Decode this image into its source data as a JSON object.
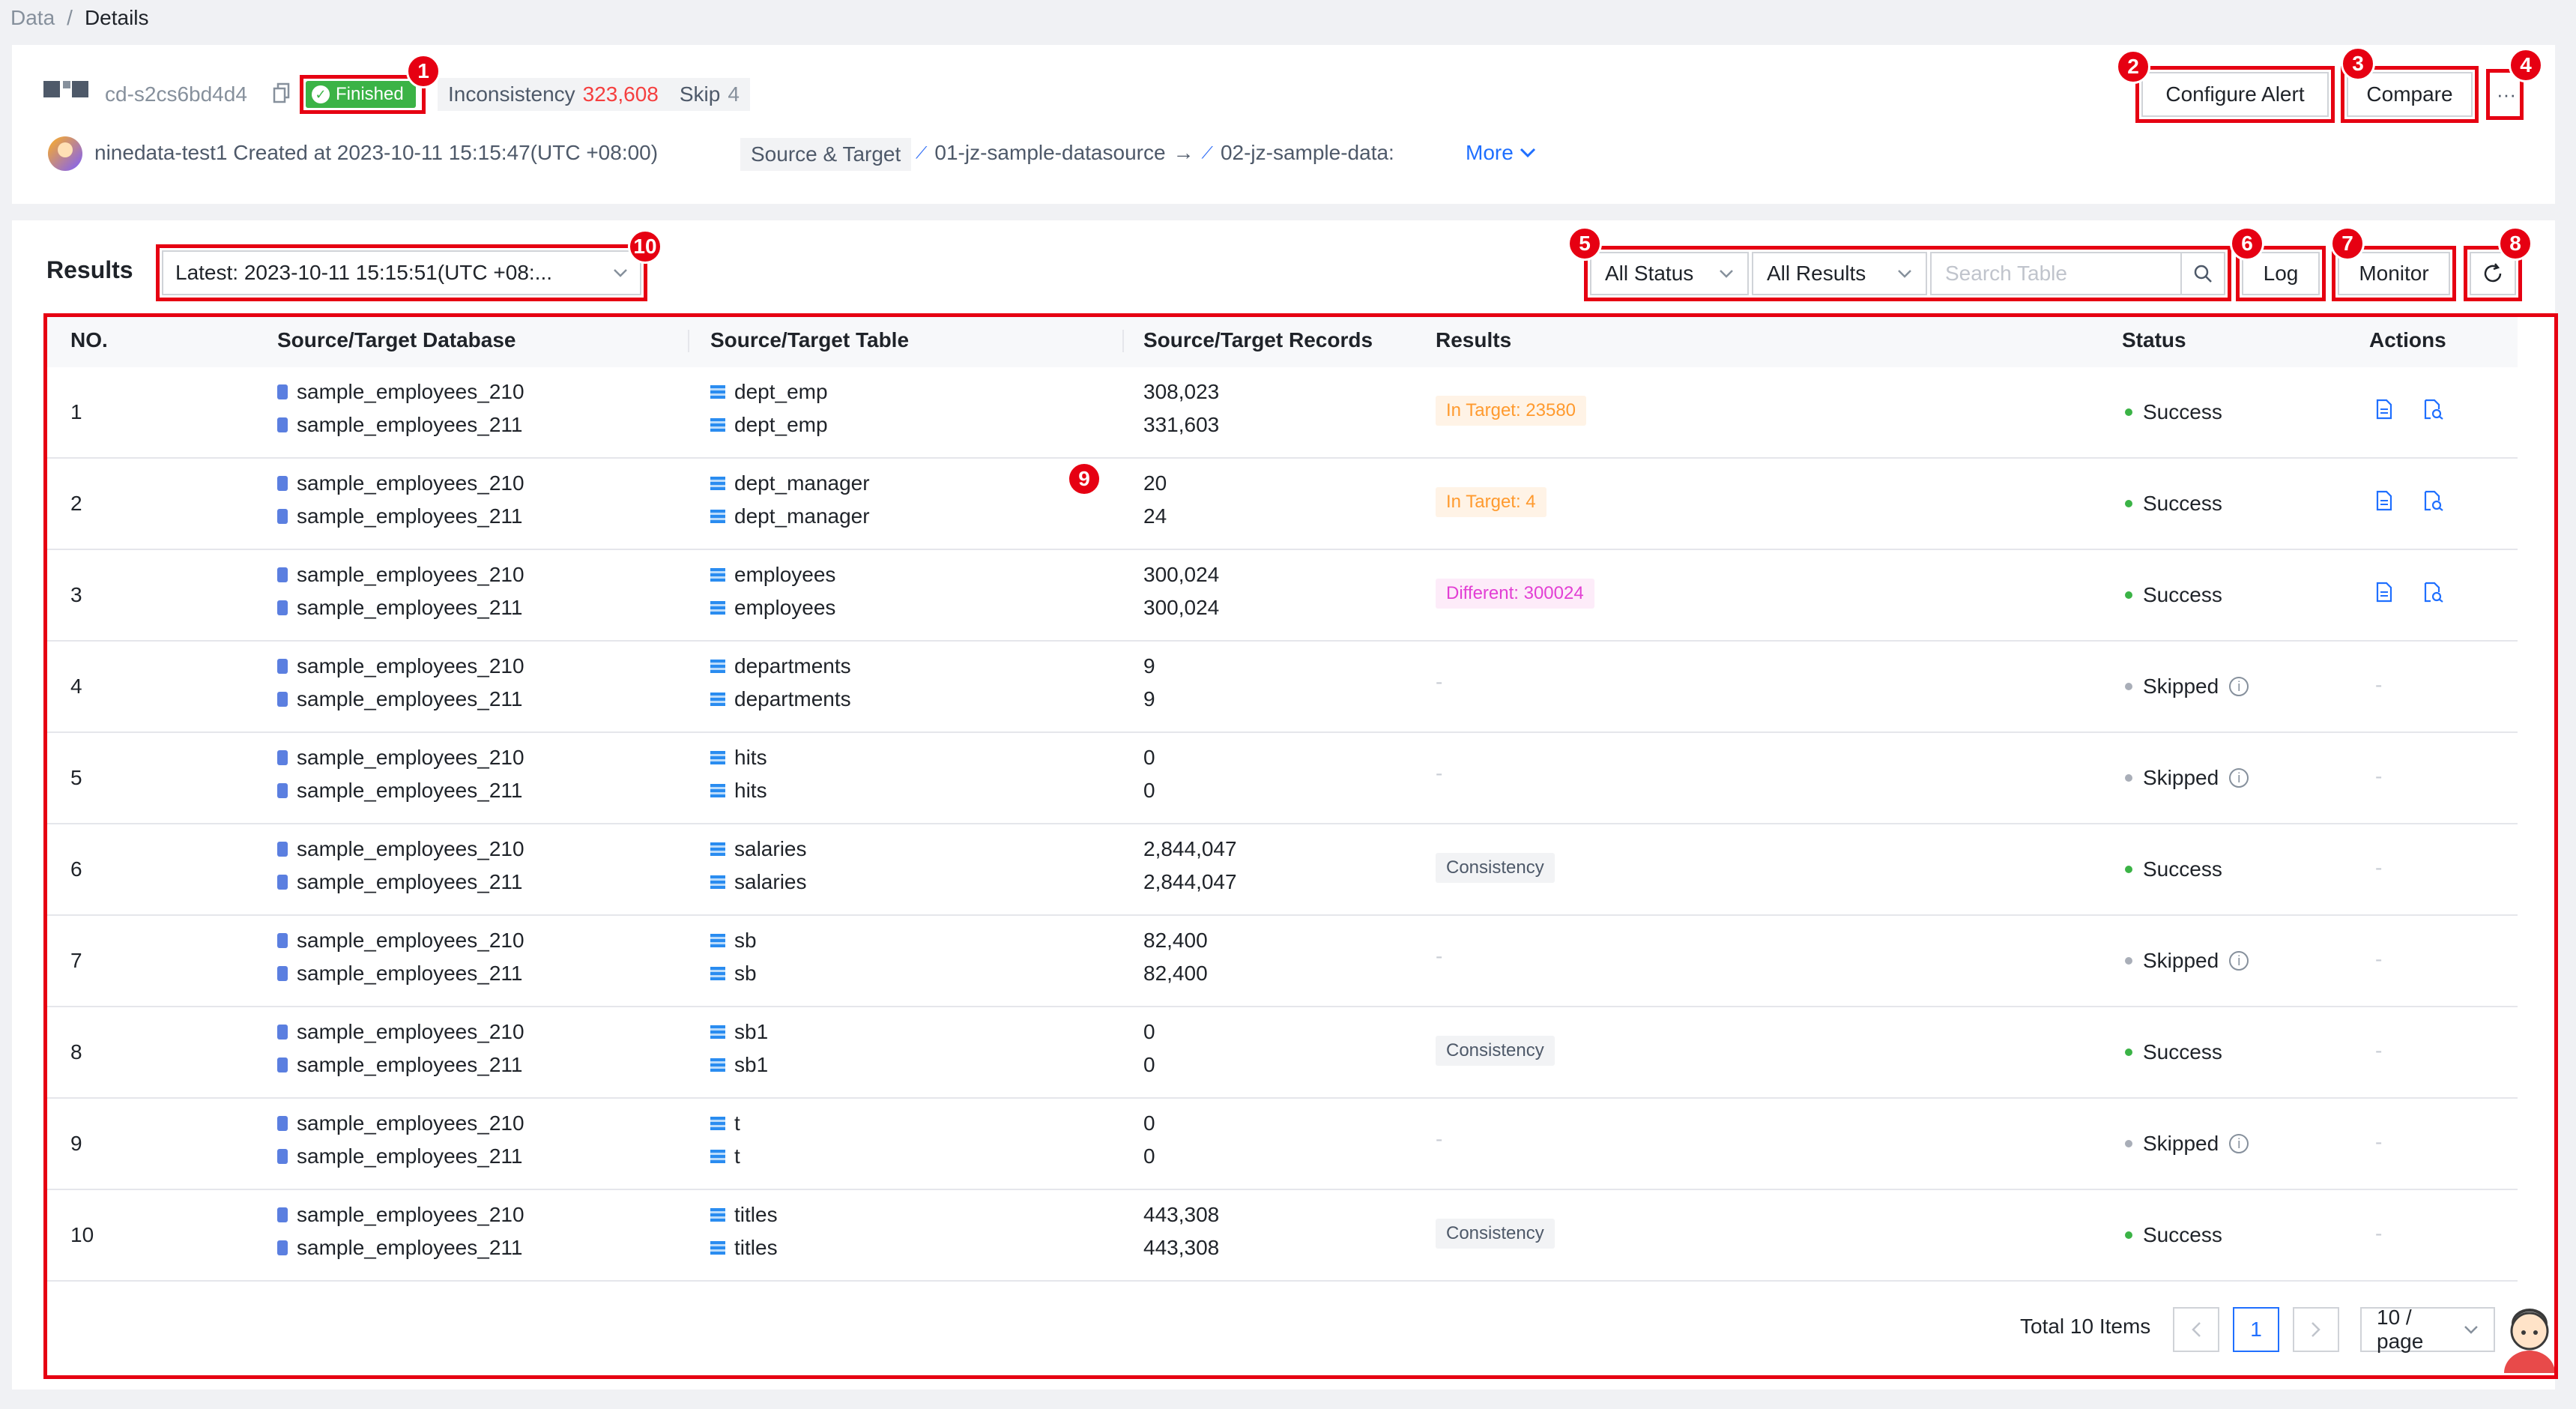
{
  "breadcrumb": {
    "root": "Data",
    "separator": "/",
    "current": "Details"
  },
  "job": {
    "id": "cd-s2cs6bd4d4",
    "status": "Finished",
    "inconsistency_label": "Inconsistency",
    "inconsistency_value": "323,608",
    "skip_label": "Skip",
    "skip_value": "4",
    "creator_text": "ninedata-test1 Created at 2023-10-11 15:15:47(UTC +08:00)",
    "source_target_label": "Source & Target",
    "source_ds": "01-jz-sample-datasource",
    "arrow": "→",
    "target_ds": "02-jz-sample-data:",
    "more_label": "More"
  },
  "header_actions": {
    "configure_alert": "Configure Alert",
    "compare": "Compare",
    "more": "···"
  },
  "results": {
    "title": "Results",
    "version": "Latest: 2023-10-11 15:15:51(UTC +08:...",
    "status_filter": "All Status",
    "results_filter": "All Results",
    "search_placeholder": "Search Table",
    "log_label": "Log",
    "monitor_label": "Monitor"
  },
  "columns": [
    "NO.",
    "Source/Target Database",
    "Source/Target Table",
    "Source/Target Records",
    "Results",
    "Status",
    "Actions"
  ],
  "rows": [
    {
      "no": "1",
      "src_db": "sample_employees_210",
      "tgt_db": "sample_employees_211",
      "src_tbl": "dept_emp",
      "tgt_tbl": "dept_emp",
      "src_rec": "308,023",
      "tgt_rec": "331,603",
      "result": "In Target: 23580",
      "status": "Success"
    },
    {
      "no": "2",
      "src_db": "sample_employees_210",
      "tgt_db": "sample_employees_211",
      "src_tbl": "dept_manager",
      "tgt_tbl": "dept_manager",
      "src_rec": "20",
      "tgt_rec": "24",
      "result": "In Target: 4",
      "status": "Success"
    },
    {
      "no": "3",
      "src_db": "sample_employees_210",
      "tgt_db": "sample_employees_211",
      "src_tbl": "employees",
      "tgt_tbl": "employees",
      "src_rec": "300,024",
      "tgt_rec": "300,024",
      "result": "Different: 300024",
      "status": "Success"
    },
    {
      "no": "4",
      "src_db": "sample_employees_210",
      "tgt_db": "sample_employees_211",
      "src_tbl": "departments",
      "tgt_tbl": "departments",
      "src_rec": "9",
      "tgt_rec": "9",
      "result": "-",
      "status": "Skipped"
    },
    {
      "no": "5",
      "src_db": "sample_employees_210",
      "tgt_db": "sample_employees_211",
      "src_tbl": "hits",
      "tgt_tbl": "hits",
      "src_rec": "0",
      "tgt_rec": "0",
      "result": "-",
      "status": "Skipped"
    },
    {
      "no": "6",
      "src_db": "sample_employees_210",
      "tgt_db": "sample_employees_211",
      "src_tbl": "salaries",
      "tgt_tbl": "salaries",
      "src_rec": "2,844,047",
      "tgt_rec": "2,844,047",
      "result": "Consistency",
      "status": "Success"
    },
    {
      "no": "7",
      "src_db": "sample_employees_210",
      "tgt_db": "sample_employees_211",
      "src_tbl": "sb",
      "tgt_tbl": "sb",
      "src_rec": "82,400",
      "tgt_rec": "82,400",
      "result": "-",
      "status": "Skipped"
    },
    {
      "no": "8",
      "src_db": "sample_employees_210",
      "tgt_db": "sample_employees_211",
      "src_tbl": "sb1",
      "tgt_tbl": "sb1",
      "src_rec": "0",
      "tgt_rec": "0",
      "result": "Consistency",
      "status": "Success"
    },
    {
      "no": "9",
      "src_db": "sample_employees_210",
      "tgt_db": "sample_employees_211",
      "src_tbl": "t",
      "tgt_tbl": "t",
      "src_rec": "0",
      "tgt_rec": "0",
      "result": "-",
      "status": "Skipped"
    },
    {
      "no": "10",
      "src_db": "sample_employees_210",
      "tgt_db": "sample_employees_211",
      "src_tbl": "titles",
      "tgt_tbl": "titles",
      "src_rec": "443,308",
      "tgt_rec": "443,308",
      "result": "Consistency",
      "status": "Success"
    }
  ],
  "pagination": {
    "total_text": "Total 10 Items",
    "current_page": "1",
    "page_size": "10 / page"
  },
  "annotations": [
    "1",
    "2",
    "3",
    "4",
    "5",
    "6",
    "7",
    "8",
    "9",
    "10"
  ],
  "colors": {
    "success": "#3bb346",
    "skipped": "#a9aeb8",
    "link": "#1f6fff",
    "annotation": "#e60012",
    "inconsistency": "#f53f3f"
  }
}
